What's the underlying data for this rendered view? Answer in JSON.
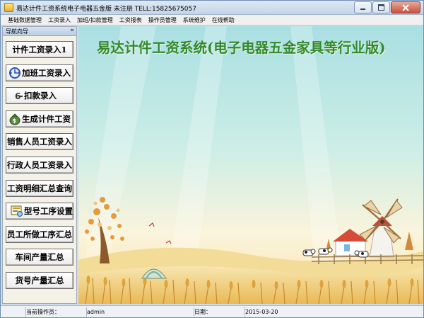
{
  "window": {
    "title": "易达计件工资系统电子电器五金版 未注册 TELL:15825675057",
    "icon": "app-icon"
  },
  "menu": [
    "基础数据管理",
    "工资录入",
    "加班/扣款管理",
    "工资报表",
    "操作员管理",
    "系统维护",
    "在线帮助"
  ],
  "nav": {
    "title": "导航向导",
    "collapse": "«",
    "items": [
      {
        "label": "计件工资录入1",
        "icon": ""
      },
      {
        "label": "加班工资录入",
        "icon": "overtime-icon"
      },
      {
        "label": "扣款录入",
        "icon": "deduction-icon"
      },
      {
        "label": "生成计件工资",
        "icon": "money-bag-icon"
      },
      {
        "label": "销售人员工资录入",
        "icon": ""
      },
      {
        "label": "行政人员工资录入",
        "icon": ""
      },
      {
        "label": "工资明细汇总查询",
        "icon": ""
      },
      {
        "label": "型号工序设置",
        "icon": "model-setup-icon"
      },
      {
        "label": "员工所做工序汇总",
        "icon": ""
      },
      {
        "label": "车间产量汇总",
        "icon": ""
      },
      {
        "label": "货号产量汇总",
        "icon": ""
      }
    ]
  },
  "banner": "易达计件工资系统(电子电器五金家具等行业版)",
  "status": {
    "operator_label": "当前操作员：",
    "operator_value": "admin",
    "date_label": "日期：",
    "date_value": "2015-03-20"
  },
  "colors": {
    "banner_text": "#2f8a2f",
    "sky_top": "#a9dfe2",
    "field": "#f2d48a",
    "window_frame": "#cfdcec"
  }
}
